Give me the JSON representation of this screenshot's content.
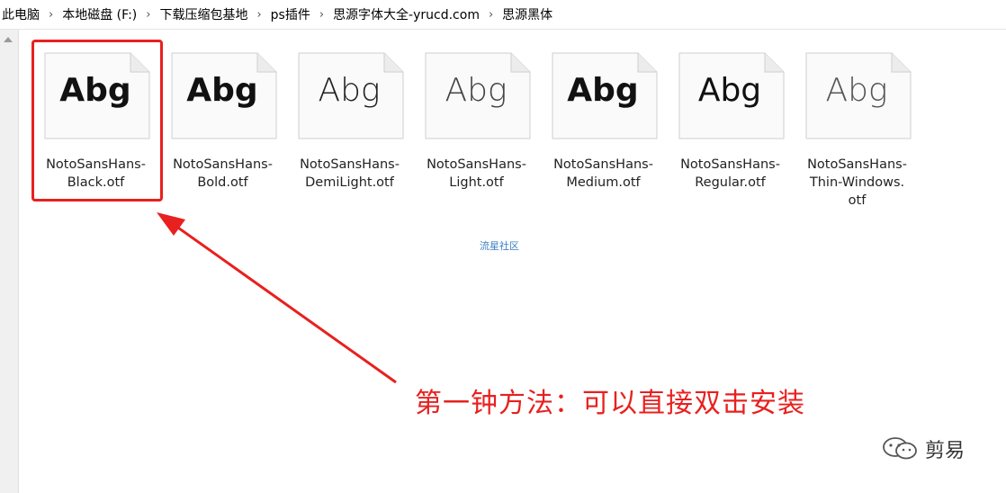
{
  "breadcrumb": [
    "此电脑",
    "本地磁盘 (F:)",
    "下载压缩包基地",
    "ps插件",
    "思源字体大全-yrucd.com",
    "思源黑体"
  ],
  "separator": "›",
  "files": [
    {
      "line1": "NotoSansHans-",
      "line2": "Black.otf",
      "line3": "",
      "weight": 900,
      "sample": "Abg"
    },
    {
      "line1": "NotoSansHans-",
      "line2": "Bold.otf",
      "line3": "",
      "weight": 700,
      "sample": "Abg"
    },
    {
      "line1": "NotoSansHans-",
      "line2": "DemiLight.otf",
      "line3": "",
      "weight": 300,
      "sample": "Abg"
    },
    {
      "line1": "NotoSansHans-",
      "line2": "Light.otf",
      "line3": "",
      "weight": 200,
      "sample": "Abg"
    },
    {
      "line1": "NotoSansHans-",
      "line2": "Medium.otf",
      "line3": "",
      "weight": 600,
      "sample": "Abg"
    },
    {
      "line1": "NotoSansHans-",
      "line2": "Regular.otf",
      "line3": "",
      "weight": 400,
      "sample": "Abg"
    },
    {
      "line1": "NotoSansHans-",
      "line2": "Thin-Windows.",
      "line3": "otf",
      "weight": 100,
      "sample": "Abg"
    }
  ],
  "watermark": "流星社区",
  "annotation": "第一钟方法：可以直接双击安装",
  "brand": "剪易",
  "colors": {
    "highlight": "#e8201f",
    "link": "#3a7fc4"
  }
}
